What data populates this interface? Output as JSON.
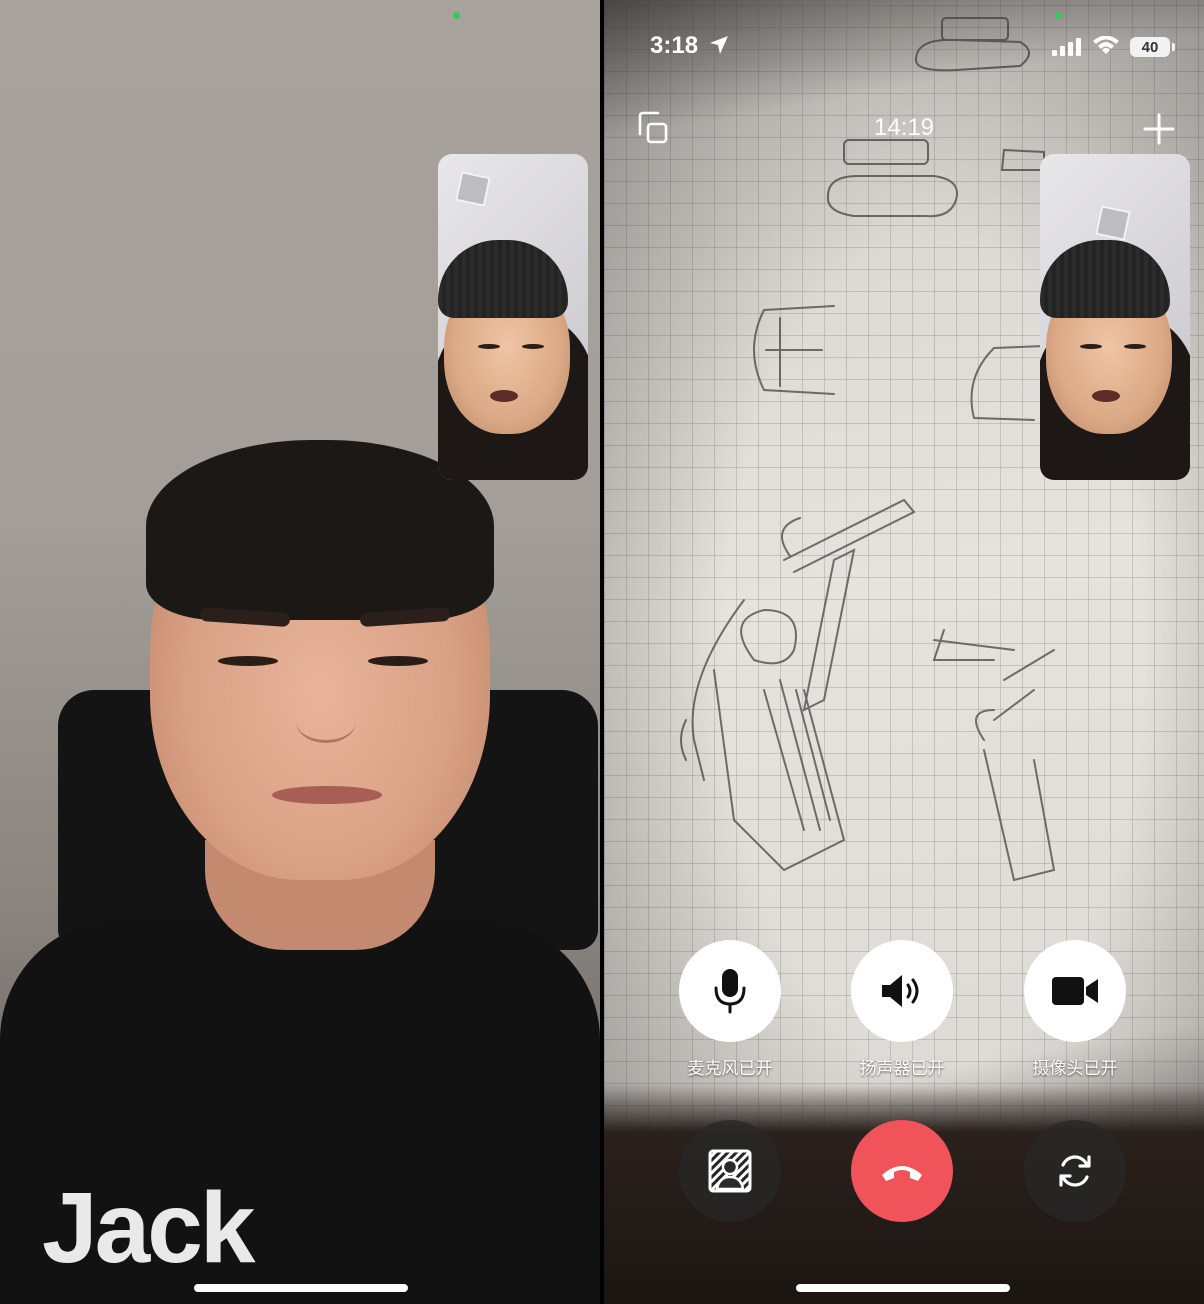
{
  "left_screen": {
    "shirt_text": "Jack"
  },
  "right_screen": {
    "status_bar": {
      "time": "3:18",
      "battery": "40"
    },
    "call": {
      "timer": "14:19"
    },
    "controls": {
      "mic_label": "麦克风已开",
      "speaker_label": "扬声器已开",
      "camera_label": "摄像头已开"
    }
  },
  "colors": {
    "hangup": "#f0535a",
    "indicator_green": "#3ac75a"
  },
  "icons": [
    "location-arrow-icon",
    "signal-icon",
    "wifi-icon",
    "battery-icon",
    "minimize-window-icon",
    "add-icon",
    "microphone-icon",
    "speaker-icon",
    "video-camera-icon",
    "background-blur-icon",
    "hang-up-icon",
    "switch-camera-icon"
  ]
}
